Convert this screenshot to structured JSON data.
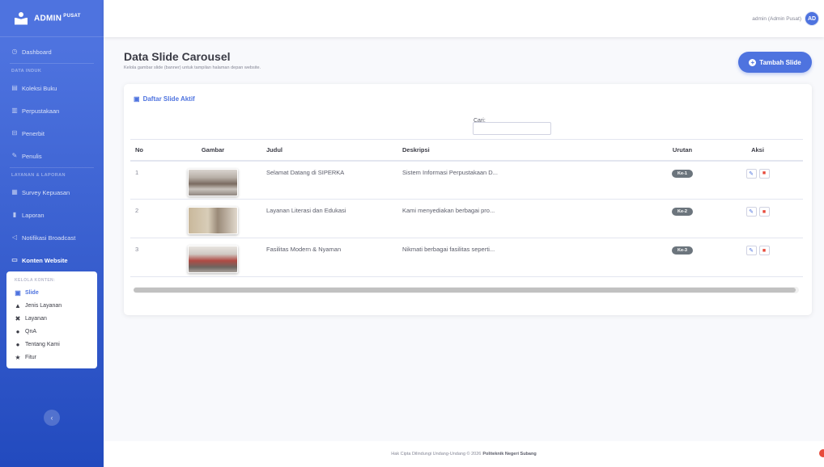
{
  "brand": {
    "name": "ADMIN",
    "sup": "PUSAT"
  },
  "sidebar": {
    "dashboard": "Dashboard",
    "heading_data": "DATA INDUK",
    "koleksi": "Koleksi Buku",
    "perpustakaan": "Perpustakaan",
    "penerbit": "Penerbit",
    "penulis": "Penulis",
    "heading_layanan": "LAYANAN & LAPORAN",
    "survey": "Survey Kepuasan",
    "laporan": "Laporan",
    "notifikasi": "Notifikasi Broadcast",
    "konten": "Konten Website",
    "submenu_heading": "KELOLA KONTEN:",
    "sub_slide": "Slide",
    "sub_jenis": "Jenis Layanan",
    "sub_layanan": "Layanan",
    "sub_qna": "QnA",
    "sub_tentang": "Tentang Kami",
    "sub_fitur": "Fitur"
  },
  "topbar": {
    "user": "admin",
    "role": "(Admin Pusat)",
    "avatar": "AD"
  },
  "page": {
    "title": "Data Slide Carousel",
    "subtitle": "Kelola gambar slide (banner) untuk tampilan halaman depan website.",
    "add_button": "Tambah Slide"
  },
  "card": {
    "title": "Daftar Slide Aktif",
    "search_label": "Cari:"
  },
  "table": {
    "headers": [
      "No",
      "Gambar",
      "Judul",
      "Deskripsi",
      "Urutan",
      "Aksi"
    ],
    "rows": [
      {
        "no": "1",
        "judul": "Selamat Datang di SIPERKA",
        "deskripsi": "Sistem Informasi Perpustakaan D...",
        "urutan": "Ke-1"
      },
      {
        "no": "2",
        "judul": "Layanan Literasi dan Edukasi",
        "deskripsi": "Kami menyediakan berbagai pro...",
        "urutan": "Ke-2"
      },
      {
        "no": "3",
        "judul": "Fasilitas Modern & Nyaman",
        "deskripsi": "Nikmati berbagai fasilitas seperti...",
        "urutan": "Ke-3"
      }
    ]
  },
  "footer": {
    "text": "Hak Cipta Dilindungi Undang-Undang © 2026",
    "org": "Politeknik Negeri Subang"
  },
  "colors": {
    "primary": "#4e73df",
    "danger": "#e74a3b",
    "badge": "#6c757d"
  }
}
